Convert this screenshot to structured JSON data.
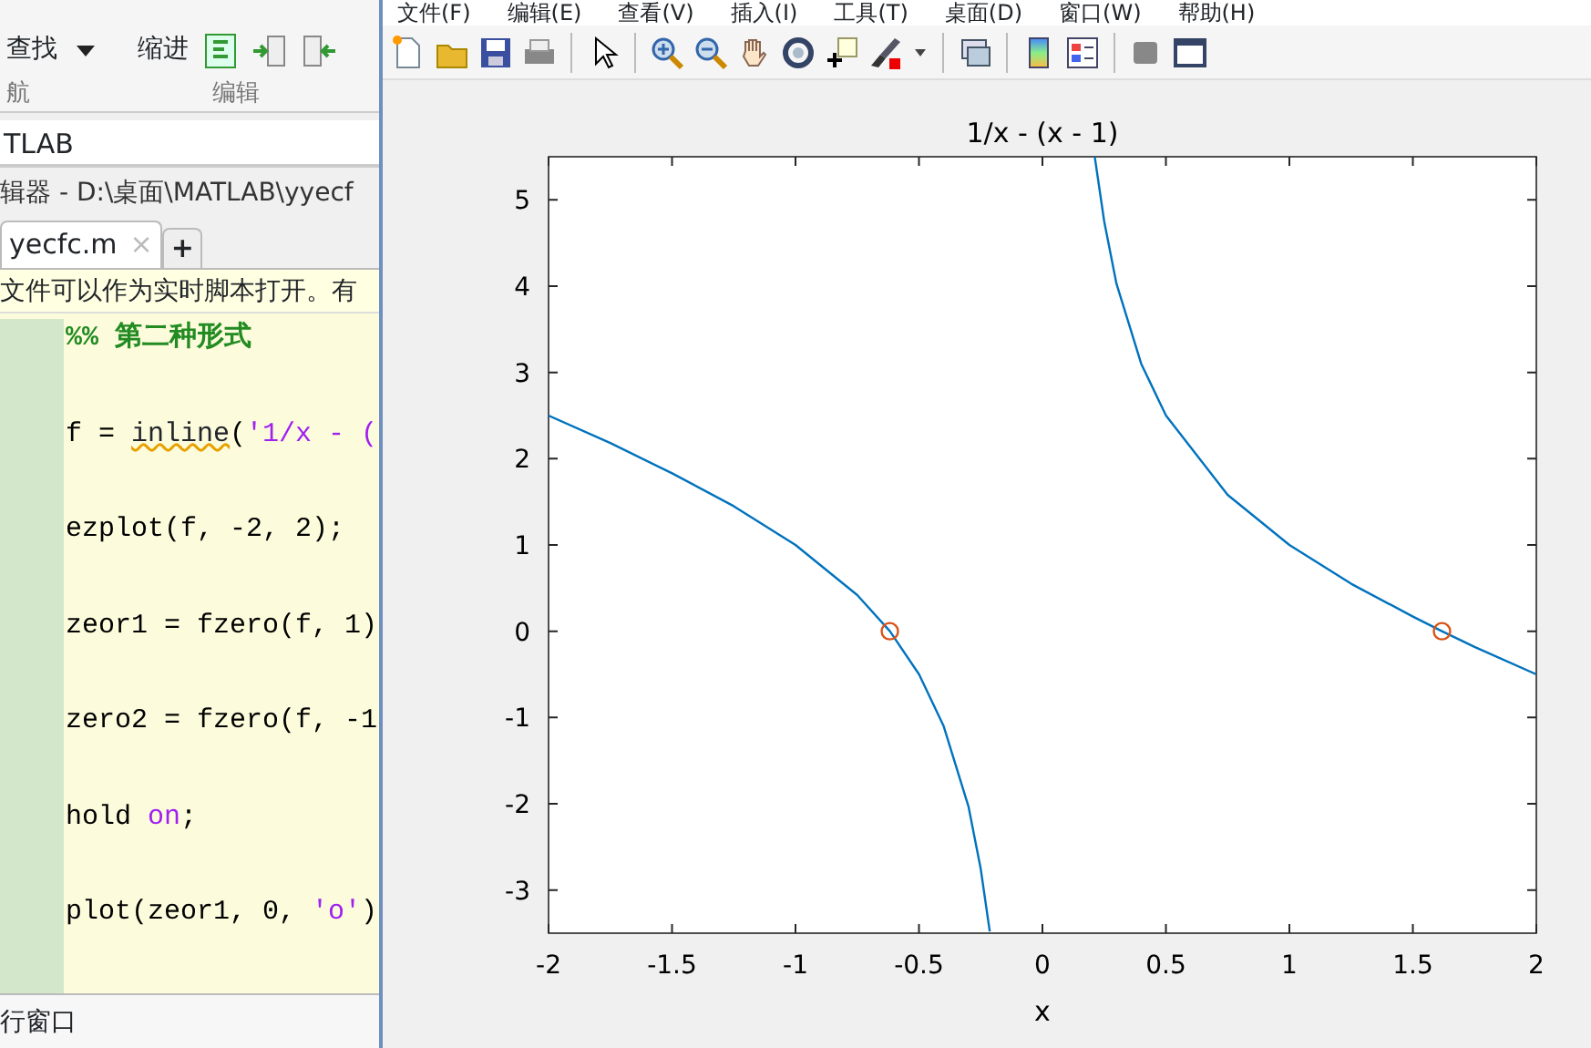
{
  "editor": {
    "toolstrip": {
      "find": "查找",
      "indent": "缩进",
      "section_labels": [
        "航",
        "编辑"
      ]
    },
    "current_folder": "TLAB",
    "editor_title": "辑器 - D:\\桌面\\MATLAB\\yyecf",
    "tabs": [
      {
        "label": "yecfc.m",
        "selected": true,
        "close": "×"
      },
      {
        "label": "+",
        "selected": false
      }
    ],
    "info_bar": "文件可以作为实时脚本打开。有",
    "code_lines": [
      [
        {
          "kind": "comment",
          "text": "%% 第二种形式"
        }
      ],
      [
        {
          "kind": "code",
          "text": "f = "
        },
        {
          "kind": "warning",
          "text": "inline"
        },
        {
          "kind": "code",
          "text": "("
        },
        {
          "kind": "string",
          "text": "'1/x - ("
        }
      ],
      [
        {
          "kind": "code",
          "text": "ezplot(f, -2, 2);"
        }
      ],
      [
        {
          "kind": "code",
          "text": "zeor1 = fzero(f, 1)"
        }
      ],
      [
        {
          "kind": "code",
          "text": "zero2 = fzero(f, -1"
        }
      ],
      [
        {
          "kind": "code",
          "text": "hold "
        },
        {
          "kind": "string",
          "text": "on"
        },
        {
          "kind": "code",
          "text": ";"
        }
      ],
      [
        {
          "kind": "code",
          "text": "plot(zeor1, 0, "
        },
        {
          "kind": "string",
          "text": "'o'"
        },
        {
          "kind": "code",
          "text": ")"
        }
      ]
    ],
    "command_window": "行窗口"
  },
  "figure": {
    "menu": [
      "文件(F)",
      "编辑(E)",
      "查看(V)",
      "插入(I)",
      "工具(T)",
      "桌面(D)",
      "窗口(W)",
      "帮助(H)"
    ],
    "chart_data": {
      "type": "line",
      "title": "1/x - (x - 1)",
      "xlabel": "x",
      "x": [
        -2,
        -1.75,
        -1.5,
        -1.25,
        -1,
        -0.75,
        -0.618,
        -0.5,
        -0.4,
        -0.3,
        -0.25,
        -0.213,
        0.212,
        0.25,
        0.3,
        0.4,
        0.5,
        0.75,
        1,
        1.25,
        1.5,
        1.618,
        1.75,
        2
      ],
      "series": [
        {
          "color": "#0072bd",
          "values": [
            2.5,
            2.18,
            1.83,
            1.45,
            1,
            0.42,
            0,
            -0.5,
            -1.1,
            -2.03,
            -2.75,
            -3.48,
            null,
            null,
            null,
            null,
            null,
            null,
            null,
            null,
            null,
            null,
            null,
            null
          ]
        },
        {
          "color": "#0072bd",
          "values": [
            null,
            null,
            null,
            null,
            null,
            null,
            null,
            null,
            null,
            null,
            null,
            null,
            5.5,
            4.75,
            4.03,
            3.1,
            2.5,
            1.58,
            1,
            0.55,
            0.17,
            0,
            -0.18,
            -0.5
          ]
        }
      ],
      "xlim": [
        -2,
        2
      ],
      "ylim": [
        -3.5,
        5.5
      ],
      "xticks": [
        -2,
        -1.5,
        -1,
        -0.5,
        0,
        0.5,
        1,
        1.5,
        2
      ],
      "yticks": [
        -3,
        -2,
        -1,
        0,
        1,
        2,
        3,
        4,
        5
      ]
    },
    "zero_markers": [
      {
        "color": "#d95319"
      },
      {
        "color": "#d95319"
      }
    ]
  }
}
